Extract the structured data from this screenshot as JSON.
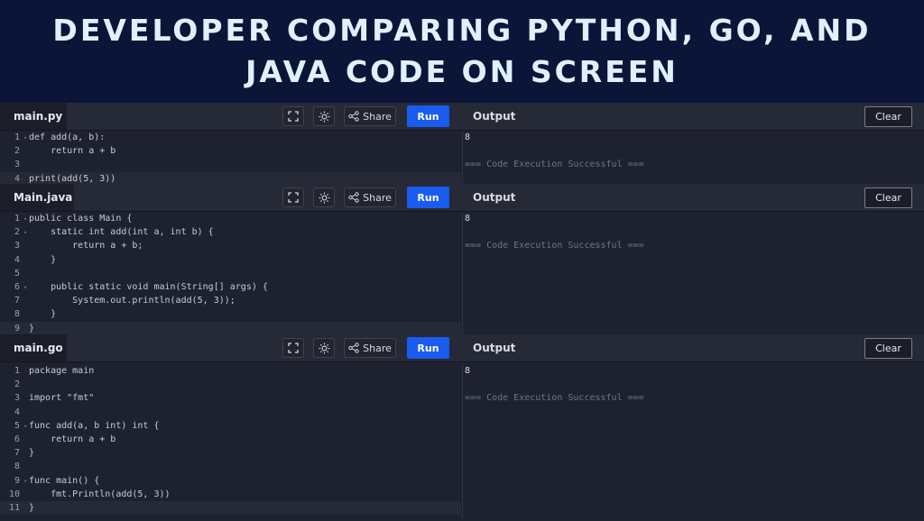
{
  "banner": {
    "title": "Developer comparing Python, Go, and Java code on screen"
  },
  "toolbar": {
    "share_label": "Share",
    "run_label": "Run",
    "output_label": "Output",
    "clear_label": "Clear"
  },
  "panels": [
    {
      "filename": "main.py",
      "lines": [
        {
          "n": "1",
          "text": "def add(a, b):",
          "fold": true
        },
        {
          "n": "2",
          "text": "    return a + b"
        },
        {
          "n": "3",
          "text": ""
        },
        {
          "n": "4",
          "text": "print(add(5, 3))",
          "active": true
        }
      ],
      "output": [
        "8",
        "",
        "=== Code Execution Successful ==="
      ]
    },
    {
      "filename": "Main.java",
      "lines": [
        {
          "n": "1",
          "text": "public class Main {",
          "fold": true
        },
        {
          "n": "2",
          "text": "    static int add(int a, int b) {",
          "fold": true
        },
        {
          "n": "3",
          "text": "        return a + b;"
        },
        {
          "n": "4",
          "text": "    }"
        },
        {
          "n": "5",
          "text": ""
        },
        {
          "n": "6",
          "text": "    public static void main(String[] args) {",
          "fold": true
        },
        {
          "n": "7",
          "text": "        System.out.println(add(5, 3));"
        },
        {
          "n": "8",
          "text": "    }"
        },
        {
          "n": "9",
          "text": "}",
          "active": true
        }
      ],
      "output": [
        "8",
        "",
        "=== Code Execution Successful ==="
      ]
    },
    {
      "filename": "main.go",
      "lines": [
        {
          "n": "1",
          "text": "package main"
        },
        {
          "n": "2",
          "text": ""
        },
        {
          "n": "3",
          "text": "import \"fmt\""
        },
        {
          "n": "4",
          "text": ""
        },
        {
          "n": "5",
          "text": "func add(a, b int) int {",
          "fold": true
        },
        {
          "n": "6",
          "text": "    return a + b"
        },
        {
          "n": "7",
          "text": "}"
        },
        {
          "n": "8",
          "text": ""
        },
        {
          "n": "9",
          "text": "func main() {",
          "fold": true
        },
        {
          "n": "10",
          "text": "    fmt.Println(add(5, 3))"
        },
        {
          "n": "11",
          "text": "}",
          "active": true
        }
      ],
      "output": [
        "8",
        "",
        "=== Code Execution Successful ==="
      ]
    }
  ]
}
